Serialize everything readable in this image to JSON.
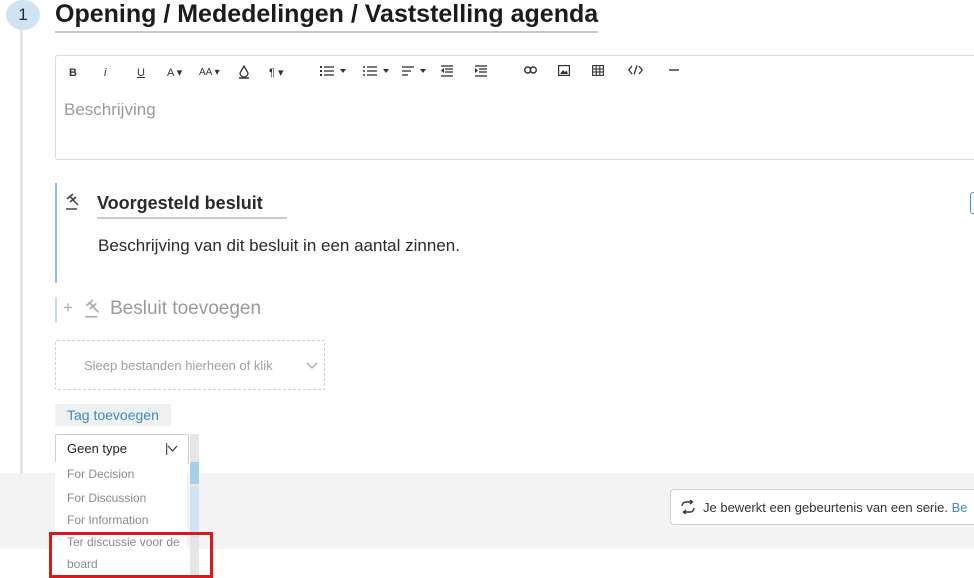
{
  "agenda_item": {
    "number": "1",
    "title": "Opening / Mededelingen / Vaststelling agenda"
  },
  "editor": {
    "toolbar": {
      "bold": "B",
      "italic": "i",
      "underline": "U",
      "text_color": "A",
      "font_size": "AA",
      "paragraph": "¶"
    },
    "placeholder": "Beschrijving"
  },
  "decision": {
    "title": "Voorgesteld besluit",
    "description": "Beschrijving van dit besluit in een aantal zinnen."
  },
  "add_decision": {
    "plus": "+",
    "label": "Besluit toevoegen"
  },
  "dropzone": {
    "text": "Sleep bestanden hierheen of klik"
  },
  "tag_button": {
    "label": "Tag toevoegen"
  },
  "type_select": {
    "selected": "Geen type",
    "options": [
      "For Decision",
      "For Discussion",
      "For Information",
      "Ter discussie voor de",
      "board"
    ]
  },
  "series_notice": {
    "text": "Je bewerkt een gebeurtenis van een serie.",
    "link": "Be"
  },
  "colors": {
    "accent": "#3d8bc5",
    "badge": "#cfe4f2",
    "highlight": "#d7191c"
  }
}
